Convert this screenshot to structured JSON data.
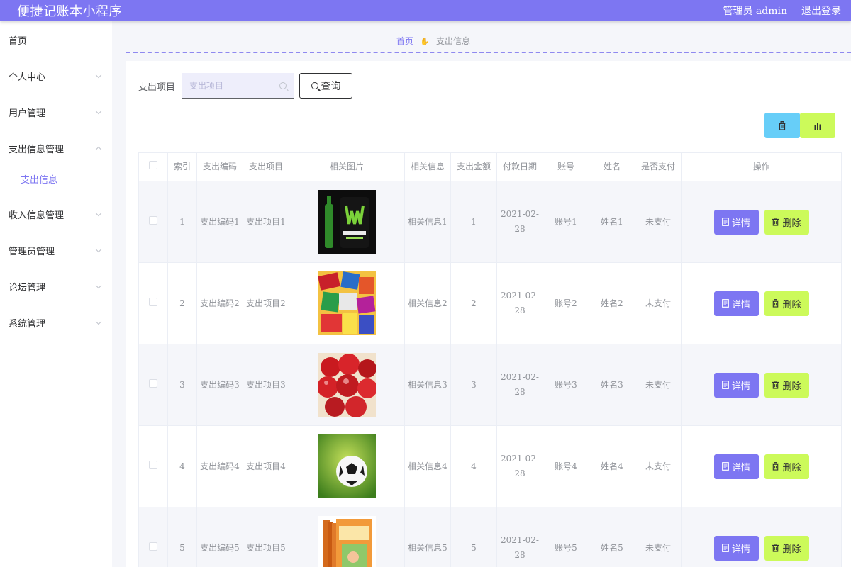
{
  "header": {
    "app_title": "便捷记账本小程序",
    "user_label": "管理员 admin",
    "logout_label": "退出登录"
  },
  "sidebar": {
    "items": [
      {
        "label": "首页",
        "has_chevron": false
      },
      {
        "label": "个人中心",
        "has_chevron": true
      },
      {
        "label": "用户管理",
        "has_chevron": true
      },
      {
        "label": "支出信息管理",
        "has_chevron": true,
        "expanded": true
      },
      {
        "label": "收入信息管理",
        "has_chevron": true
      },
      {
        "label": "管理员管理",
        "has_chevron": true
      },
      {
        "label": "论坛管理",
        "has_chevron": true
      },
      {
        "label": "系统管理",
        "has_chevron": true
      }
    ],
    "active_sub": "支出信息"
  },
  "breadcrumb": {
    "home": "首页",
    "current": "支出信息"
  },
  "search": {
    "label": "支出项目",
    "placeholder": "支出项目",
    "value": "",
    "button_label": "查询"
  },
  "colors": {
    "primary": "#7d76f2",
    "lime": "#ccfa5a",
    "sky": "#67cef8"
  },
  "table": {
    "headers": [
      "",
      "索引",
      "支出编码",
      "支出项目",
      "相关图片",
      "相关信息",
      "支出金额",
      "付款日期",
      "账号",
      "姓名",
      "是否支付",
      "操作"
    ],
    "detail_label": "详情",
    "delete_label": "删除",
    "rows": [
      {
        "index": "1",
        "code": "支出编码1",
        "item": "支出项目1",
        "image": "energy-drink-can",
        "info": "相关信息1",
        "amount": "1",
        "date": "2021-02-28",
        "account": "账号1",
        "name": "姓名1",
        "paid": "未支付"
      },
      {
        "index": "2",
        "code": "支出编码2",
        "item": "支出项目2",
        "image": "snack-pile",
        "info": "相关信息2",
        "amount": "2",
        "date": "2021-02-28",
        "account": "账号2",
        "name": "姓名2",
        "paid": "未支付"
      },
      {
        "index": "3",
        "code": "支出编码3",
        "item": "支出项目3",
        "image": "cherries",
        "info": "相关信息3",
        "amount": "3",
        "date": "2021-02-28",
        "account": "账号3",
        "name": "姓名3",
        "paid": "未支付"
      },
      {
        "index": "4",
        "code": "支出编码4",
        "item": "支出项目4",
        "image": "soccer-ball",
        "info": "相关信息4",
        "amount": "4",
        "date": "2021-02-28",
        "account": "账号4",
        "name": "姓名4",
        "paid": "未支付"
      },
      {
        "index": "5",
        "code": "支出编码5",
        "item": "支出项目5",
        "image": "book-stack",
        "info": "相关信息5",
        "amount": "5",
        "date": "2021-02-28",
        "account": "账号5",
        "name": "姓名5",
        "paid": "未支付"
      }
    ]
  }
}
